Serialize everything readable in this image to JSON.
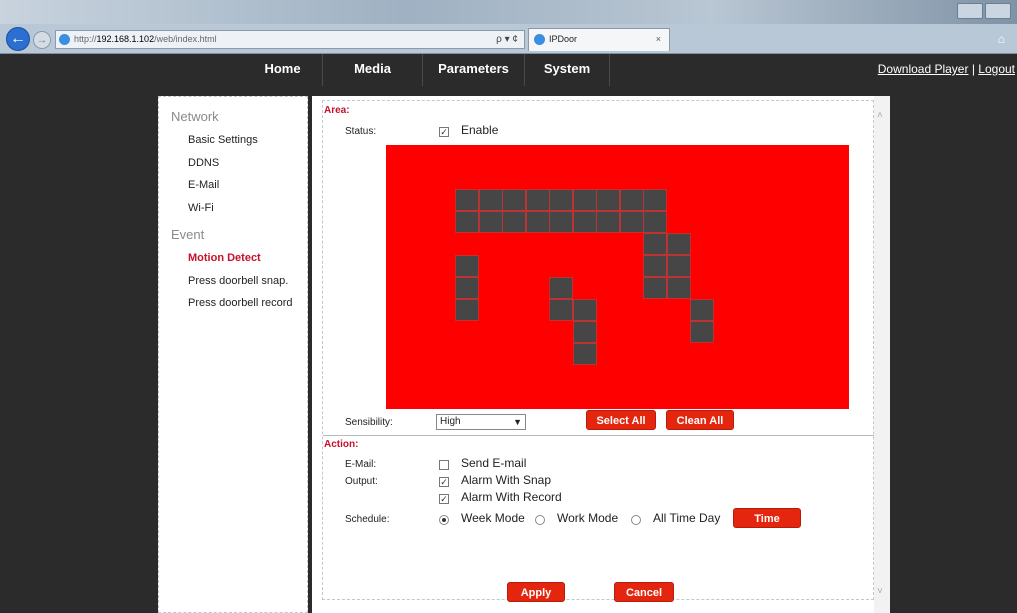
{
  "browser": {
    "url_prefix": "http://",
    "url_host": "192.168.1.102",
    "url_path": "/web/index.html",
    "url_tools": "ρ ▾ ¢",
    "tab_title": "IPDoor",
    "tab_close": "×"
  },
  "nav": {
    "home": "Home",
    "media": "Media",
    "parameters": "Parameters",
    "system": "System",
    "download_player": "Download Player",
    "separator": "|",
    "logout": "Logout"
  },
  "sidebar": {
    "network_heading": "Network",
    "network_items": [
      "Basic Settings",
      "DDNS",
      "E-Mail",
      "Wi-Fi"
    ],
    "event_heading": "Event",
    "event_items": [
      "Motion Detect",
      "Press doorbell snap.",
      "Press doorbell record"
    ],
    "active_item": "Motion Detect"
  },
  "area": {
    "section": "Area:",
    "status_label": "Status:",
    "status_enabled": true,
    "enable_label": "Enable",
    "sensibility_label": "Sensibility:",
    "sensibility_value": "High",
    "select_all": "Select All",
    "clean_all": "Clean All"
  },
  "action": {
    "section": "Action:",
    "email_label": "E-Mail:",
    "send_email": "Send E-mail",
    "send_email_checked": false,
    "output_label": "Output:",
    "alarm_snap": "Alarm With Snap",
    "alarm_snap_checked": true,
    "alarm_record": "Alarm With Record",
    "alarm_record_checked": true,
    "schedule_label": "Schedule:",
    "week_mode": "Week Mode",
    "work_mode": "Work Mode",
    "all_time_day": "All Time Day",
    "selected_schedule": "Week Mode",
    "time_button": "Time"
  },
  "footer": {
    "apply": "Apply",
    "cancel": "Cancel"
  },
  "colors": {
    "accent": "#e5260f",
    "area_background": "#ff0000",
    "selected_cell": "#464646",
    "active_menu": "#c8102e"
  }
}
